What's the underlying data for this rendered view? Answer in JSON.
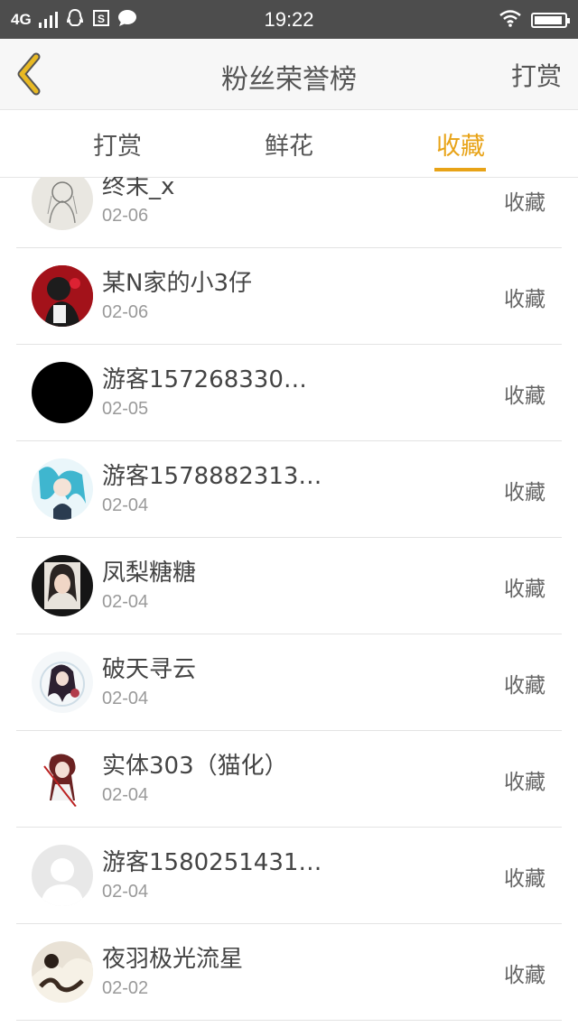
{
  "status_bar": {
    "network": "4G",
    "time": "19:22"
  },
  "header": {
    "title": "粉丝荣誉榜",
    "right_action": "打赏"
  },
  "tabs": [
    {
      "label": "打赏",
      "active": false
    },
    {
      "label": "鲜花",
      "active": false
    },
    {
      "label": "收藏",
      "active": true
    }
  ],
  "accent_color": "#e8a317",
  "fans": [
    {
      "name": "终末_x",
      "date": "02-06",
      "action": "收藏",
      "avatar": "sketch-avatar"
    },
    {
      "name": "某N家的小3仔",
      "date": "02-06",
      "action": "收藏",
      "avatar": "red-character-avatar"
    },
    {
      "name": "游客157268330…",
      "date": "02-05",
      "action": "收藏",
      "avatar": "black-avatar"
    },
    {
      "name": "游客1578882313…",
      "date": "02-04",
      "action": "收藏",
      "avatar": "anime-teal-hair-avatar"
    },
    {
      "name": "凤梨糖糖",
      "date": "02-04",
      "action": "收藏",
      "avatar": "portrait-avatar"
    },
    {
      "name": "破天寻云",
      "date": "02-04",
      "action": "收藏",
      "avatar": "anime-dark-avatar"
    },
    {
      "name": "实体303（猫化）",
      "date": "02-04",
      "action": "收藏",
      "avatar": "chibi-character-avatar"
    },
    {
      "name": "游客1580251431…",
      "date": "02-04",
      "action": "收藏",
      "avatar": "default-user-avatar"
    },
    {
      "name": "夜羽极光流星",
      "date": "02-02",
      "action": "收藏",
      "avatar": "artwork-avatar"
    }
  ]
}
